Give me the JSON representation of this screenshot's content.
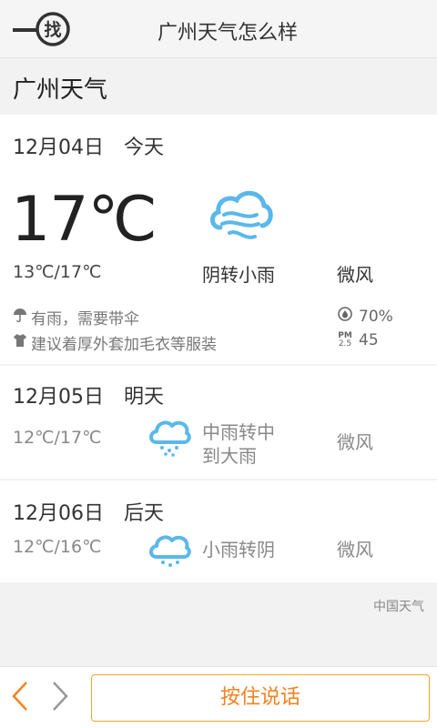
{
  "header": {
    "logo_char": "找",
    "query": "广州天气怎么样"
  },
  "city_title": "广州天气",
  "today": {
    "date": "12月04日",
    "day": "今天",
    "temp": "17℃",
    "range": "13℃/17℃",
    "condition": "阴转小雨",
    "wind": "微风",
    "tip_umbrella": "有雨，需要带伞",
    "tip_clothes": "建议着厚外套加毛衣等服装",
    "humidity": "70%",
    "pm_label_top": "PM",
    "pm_label_bottom": "2.5",
    "pm": "45",
    "icon": "cloud-wind-icon"
  },
  "forecast": [
    {
      "date": "12月05日",
      "day": "明天",
      "range": "12℃/17℃",
      "condition_line1": "中雨转中",
      "condition_line2": "到大雨",
      "wind": "微风",
      "icon": "cloud-rain-icon"
    },
    {
      "date": "12月06日",
      "day": "后天",
      "range": "12℃/16℃",
      "condition": "小雨转阴",
      "wind": "微风",
      "icon": "cloud-rain-icon"
    }
  ],
  "source": "中国天气",
  "bottom": {
    "speak_label": "按住说话"
  },
  "colors": {
    "accent": "#f5821f",
    "icon_blue": "#5ab8ea"
  }
}
